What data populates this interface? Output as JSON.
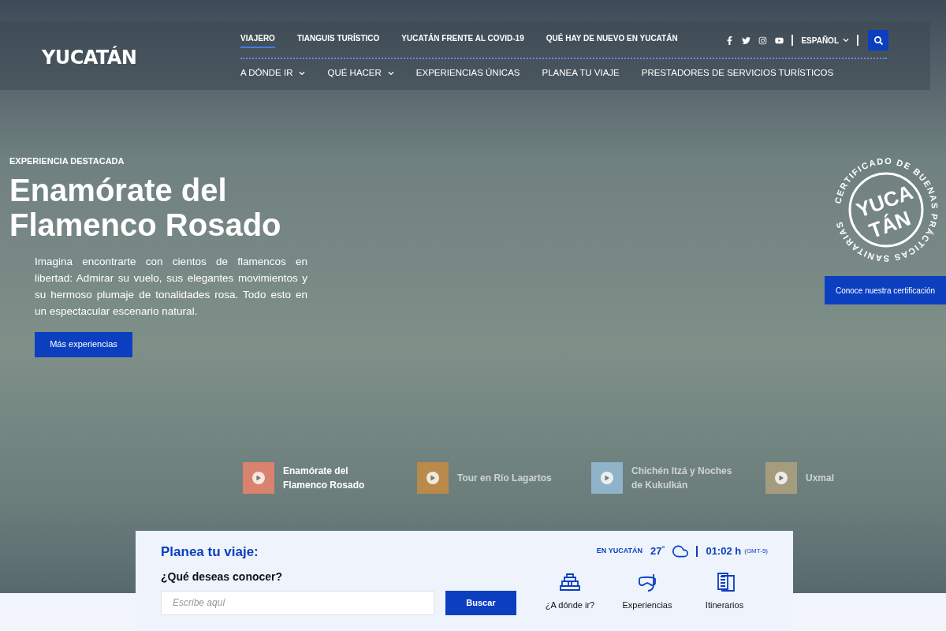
{
  "header": {
    "logo": "YUCATÁN",
    "top_nav": [
      {
        "label": "VIAJERO",
        "selected": true
      },
      {
        "label": "TIANGUIS TURÍSTICO",
        "selected": false
      },
      {
        "label": "YUCATÁN FRENTE AL COVID-19",
        "selected": false
      },
      {
        "label": "QUÉ HAY DE NUEVO EN YUCATÁN",
        "selected": false
      }
    ],
    "social": [
      {
        "kind": "facebook"
      },
      {
        "kind": "twitter"
      },
      {
        "kind": "instagram"
      },
      {
        "kind": "youtube"
      }
    ],
    "language": "ESPAÑOL",
    "main_nav": [
      {
        "label": "A DÓNDE IR",
        "dropdown": true
      },
      {
        "label": "QUÉ HACER",
        "dropdown": true
      },
      {
        "label": "EXPERIENCIAS ÚNICAS",
        "dropdown": false
      },
      {
        "label": "PLANEA TU VIAJE",
        "dropdown": false
      },
      {
        "label": "PRESTADORES DE SERVICIOS TURÍSTICOS",
        "dropdown": false
      }
    ]
  },
  "hero": {
    "eyebrow": "EXPERIENCIA DESTACADA",
    "title": "Enamórate del Flamenco Rosado",
    "description": "Imagina encontrarte con cientos de flamencos en libertad: Admirar su vuelo, sus elegantes movimientos y su hermoso plumaje de tonalidades rosa. Todo esto en un espectacular escenario natural.",
    "button": "Más experiencias"
  },
  "certification": {
    "seal_ring": "CERTIFICADO DE BUENAS PRÁCTICAS SANITARIAS",
    "seal_top": "YUCA",
    "seal_bottom": "TÁN",
    "button": "Conoce nuestra certificación"
  },
  "experiences": [
    {
      "title": "Enamórate del Flamenco Rosado",
      "selected": true,
      "color": "#d9826e"
    },
    {
      "title": "Tour en Río Lagartos",
      "selected": false,
      "color": "#b98a4a"
    },
    {
      "title": "Chichén Itzá y Noches de Kukulkán",
      "selected": false,
      "color": "#8fb3c9"
    },
    {
      "title": "Uxmal",
      "selected": false,
      "color": "#a59c7e"
    }
  ],
  "planner": {
    "title": "Planea tu viaje:",
    "question": "¿Qué deseas conocer?",
    "search": {
      "placeholder": "Escribe aquí"
    },
    "button": "Buscar",
    "weather": {
      "location": "EN YUCATÁN",
      "temperature": "27$^{°}$",
      "time": "01:02 h",
      "timezone": "(GMT-5)"
    },
    "shortcuts": [
      {
        "label": "¿A dónde ir?",
        "kind": "pyramid"
      },
      {
        "label": "Experiencias",
        "kind": "snorkel"
      },
      {
        "label": "Itinerarios",
        "kind": "document"
      }
    ]
  }
}
